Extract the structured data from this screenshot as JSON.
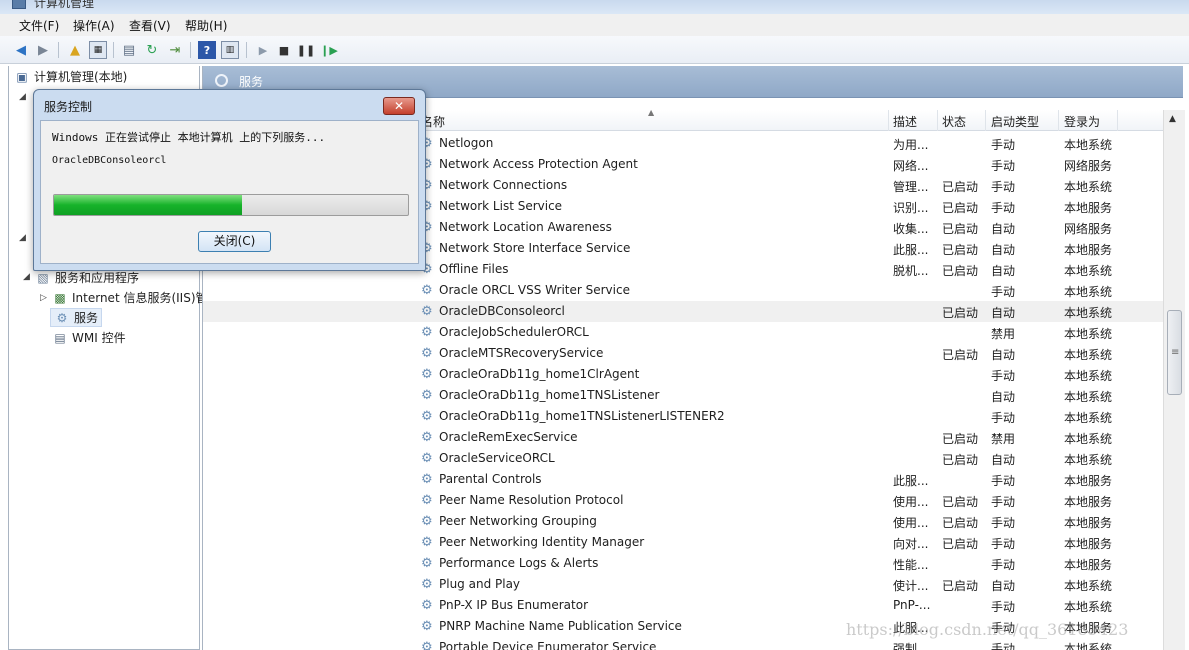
{
  "window": {
    "title": "计算机管理"
  },
  "menu": [
    "文件(F)",
    "操作(A)",
    "查看(V)",
    "帮助(H)"
  ],
  "toolbar": {
    "icons": [
      "back-arrow",
      "forward-arrow",
      "up-folder",
      "show-hide-tree",
      "properties",
      "refresh",
      "export-list",
      "help",
      "show-hide-action-pane",
      "start-service",
      "stop-service",
      "pause-service",
      "restart-service"
    ]
  },
  "tree": {
    "root": "计算机管理(本地)",
    "services_and_apps": "服务和应用程序",
    "iis": "Internet 信息服务(IIS)管",
    "services": "服务",
    "wmi": "WMI 控件"
  },
  "pane": {
    "title": "服务"
  },
  "columns": {
    "name": "名称",
    "desc": "描述",
    "status": "状态",
    "startup": "启动类型",
    "logon": "登录为"
  },
  "services": [
    {
      "name": "Netlogon",
      "desc": "为用...",
      "status": "",
      "startup": "手动",
      "logon": "本地系统"
    },
    {
      "name": "Network Access Protection Agent",
      "desc": "网络...",
      "status": "",
      "startup": "手动",
      "logon": "网络服务"
    },
    {
      "name": "Network Connections",
      "desc": "管理...",
      "status": "已启动",
      "startup": "手动",
      "logon": "本地系统"
    },
    {
      "name": "Network List Service",
      "desc": "识别...",
      "status": "已启动",
      "startup": "手动",
      "logon": "本地服务"
    },
    {
      "name": "Network Location Awareness",
      "desc": "收集...",
      "status": "已启动",
      "startup": "自动",
      "logon": "网络服务"
    },
    {
      "name": "Network Store Interface Service",
      "desc": "此服...",
      "status": "已启动",
      "startup": "自动",
      "logon": "本地服务"
    },
    {
      "name": "Offline Files",
      "desc": "脱机...",
      "status": "已启动",
      "startup": "自动",
      "logon": "本地系统"
    },
    {
      "name": "Oracle ORCL VSS Writer Service",
      "desc": "",
      "status": "",
      "startup": "手动",
      "logon": "本地系统"
    },
    {
      "name": "OracleDBConsoleorcl",
      "desc": "",
      "status": "已启动",
      "startup": "自动",
      "logon": "本地系统"
    },
    {
      "name": "OracleJobSchedulerORCL",
      "desc": "",
      "status": "",
      "startup": "禁用",
      "logon": "本地系统"
    },
    {
      "name": "OracleMTSRecoveryService",
      "desc": "",
      "status": "已启动",
      "startup": "自动",
      "logon": "本地系统"
    },
    {
      "name": "OracleOraDb11g_home1ClrAgent",
      "desc": "",
      "status": "",
      "startup": "手动",
      "logon": "本地系统"
    },
    {
      "name": "OracleOraDb11g_home1TNSListener",
      "desc": "",
      "status": "",
      "startup": "自动",
      "logon": "本地系统"
    },
    {
      "name": "OracleOraDb11g_home1TNSListenerLISTENER2",
      "desc": "",
      "status": "",
      "startup": "手动",
      "logon": "本地系统"
    },
    {
      "name": "OracleRemExecService",
      "desc": "",
      "status": "已启动",
      "startup": "禁用",
      "logon": "本地系统"
    },
    {
      "name": "OracleServiceORCL",
      "desc": "",
      "status": "已启动",
      "startup": "自动",
      "logon": "本地系统"
    },
    {
      "name": "Parental Controls",
      "desc": "此服...",
      "status": "",
      "startup": "手动",
      "logon": "本地服务"
    },
    {
      "name": "Peer Name Resolution Protocol",
      "desc": "使用...",
      "status": "已启动",
      "startup": "手动",
      "logon": "本地服务"
    },
    {
      "name": "Peer Networking Grouping",
      "desc": "使用...",
      "status": "已启动",
      "startup": "手动",
      "logon": "本地服务"
    },
    {
      "name": "Peer Networking Identity Manager",
      "desc": "向对...",
      "status": "已启动",
      "startup": "手动",
      "logon": "本地服务"
    },
    {
      "name": "Performance Logs & Alerts",
      "desc": "性能...",
      "status": "",
      "startup": "手动",
      "logon": "本地服务"
    },
    {
      "name": "Plug and Play",
      "desc": "使计...",
      "status": "已启动",
      "startup": "自动",
      "logon": "本地系统"
    },
    {
      "name": "PnP-X IP Bus Enumerator",
      "desc": "PnP-...",
      "status": "",
      "startup": "手动",
      "logon": "本地系统"
    },
    {
      "name": "PNRP Machine Name Publication Service",
      "desc": "此服...",
      "status": "",
      "startup": "手动",
      "logon": "本地服务"
    },
    {
      "name": "Portable Device Enumerator Service",
      "desc": "强制...",
      "status": "",
      "startup": "手动",
      "logon": "本地系统"
    }
  ],
  "highlighted_row": 8,
  "dialog": {
    "title": "服务控制",
    "message": "Windows 正在尝试停止 本地计算机 上的下列服务...",
    "service": "OracleDBConsoleorcl",
    "progress": 0.53,
    "close_button": "关闭(C)"
  },
  "watermark": "https://blog.csdn.net/qq_36189423",
  "colors": {
    "progress": "#17b32a",
    "pane_header": "#9db3cf",
    "dialog_frame": "#cbdcf0"
  }
}
